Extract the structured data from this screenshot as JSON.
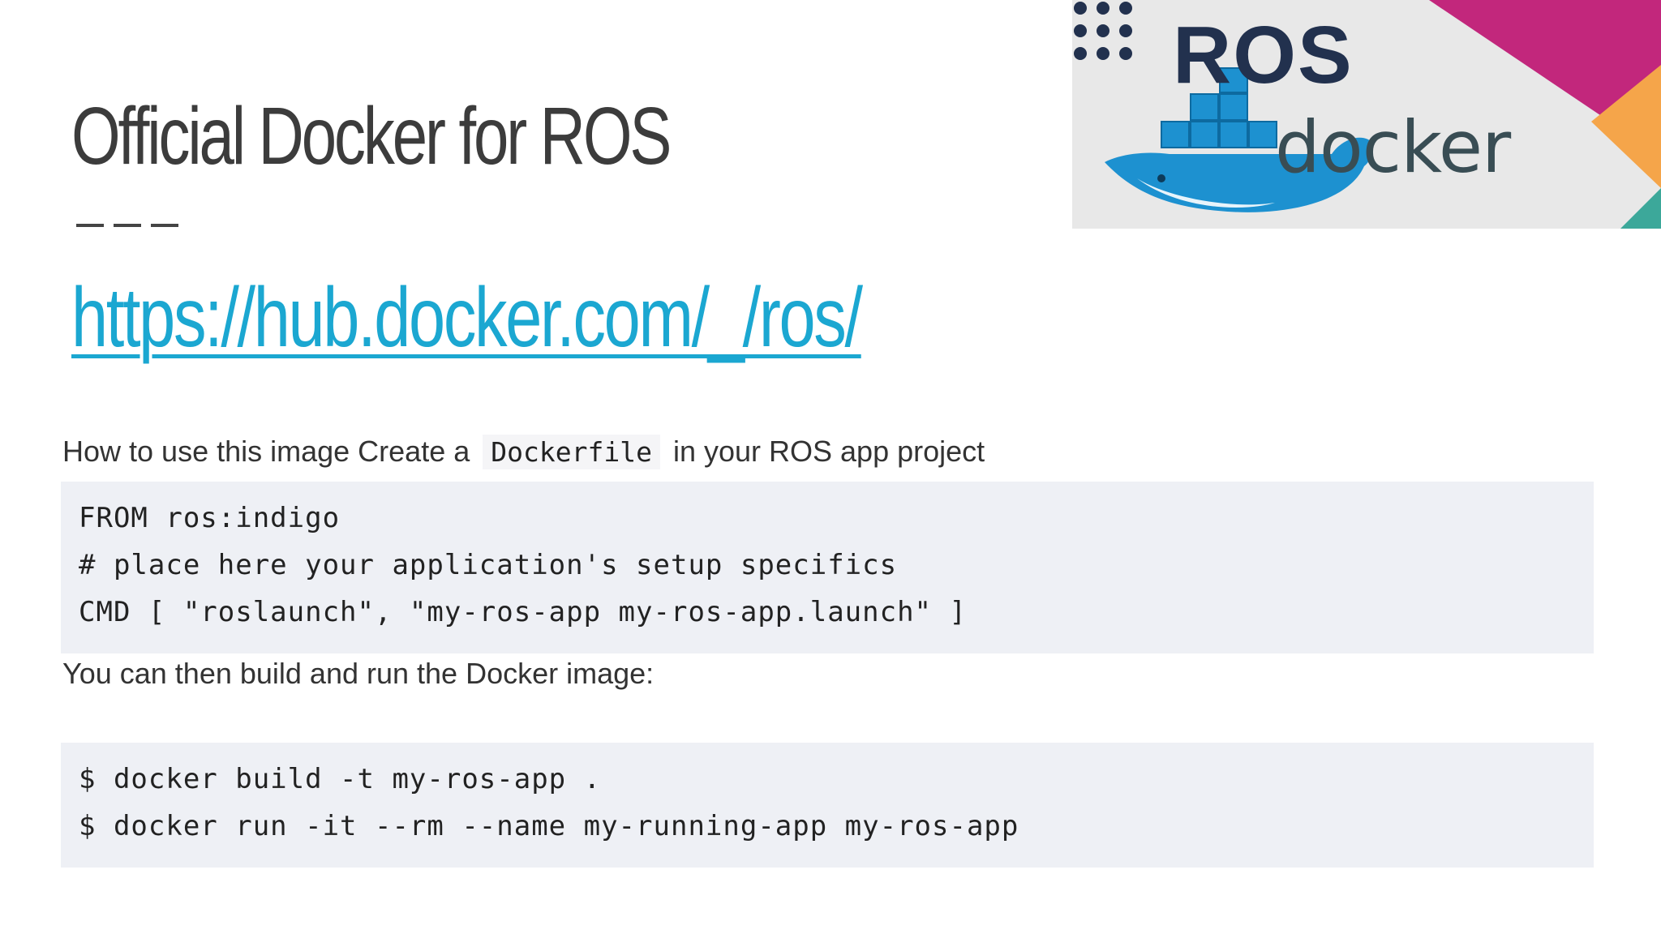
{
  "slide": {
    "title": "Official Docker for ROS",
    "link": "https://hub.docker.com/_/ros/"
  },
  "logo": {
    "ros_text": "ROS",
    "docker_text": "docker"
  },
  "doc": {
    "intro_before": "How to use this image Create a",
    "intro_code": "Dockerfile",
    "intro_after": "in your ROS app project",
    "dockerfile_lines": [
      "FROM ros:indigo",
      "# place here your application's setup specifics",
      "CMD [ \"roslaunch\", \"my-ros-app my-ros-app.launch\" ]"
    ],
    "build_text": "You can then build and run the Docker image:",
    "shell_lines": [
      "$ docker build -t my-ros-app .",
      "$ docker run -it --rm --name my-running-app my-ros-app"
    ]
  },
  "colors": {
    "link": "#1ba7d1",
    "title": "#3c3c3c",
    "code_bg": "#eef0f5",
    "ros_navy": "#22314e",
    "docker_blue": "#1d91d0",
    "magenta": "#c2277c",
    "orange": "#f5a54a"
  }
}
